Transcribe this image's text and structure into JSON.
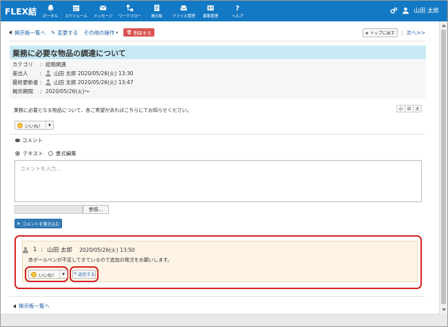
{
  "app": {
    "logo": "FLEX結"
  },
  "nav": [
    {
      "label": "ポータル",
      "icon": "bell-icon"
    },
    {
      "label": "スケジュール",
      "icon": "calendar-icon"
    },
    {
      "label": "メッセージ",
      "icon": "envelope-icon"
    },
    {
      "label": "ワークフロー",
      "icon": "workflow-icon"
    },
    {
      "label": "掲示板",
      "icon": "bulletin-icon"
    },
    {
      "label": "ファイル管理",
      "icon": "inbox-icon"
    },
    {
      "label": "顧客管理",
      "icon": "customer-icon"
    },
    {
      "label": "ヘルプ",
      "icon": "question-icon"
    }
  ],
  "user": {
    "name": "山田 太郎"
  },
  "toolbar": {
    "back": "掲示板一覧へ",
    "edit": "変更する",
    "other": "その他の操作",
    "delete": "削除する",
    "to_top": "トップに出す",
    "next": "次へ>>"
  },
  "post": {
    "title": "業務に必要な物品の調達について",
    "category_label": "カテゴリ",
    "category_value": "総務関連",
    "sender_label": "差出人",
    "sender_name": "山田 太郎",
    "sender_date": "2020/05/26(火) 13:30",
    "updater_label": "最終更新者",
    "updater_name": "山田 太郎",
    "updater_date": "2020/05/26(火) 13:47",
    "period_label": "掲示期間",
    "period_value": "2020/05/26(火)～",
    "sep": ":",
    "body": "業務に必要となる物品について、各ご希望があればこちらにてお知らせください。",
    "size_small": "小",
    "size_mid": "中",
    "size_large": "大",
    "like": "いいね！"
  },
  "comment_form": {
    "heading": "コメント",
    "mode_text": "テキスト",
    "mode_rich": "書式編集",
    "placeholder": "コメントを入力...",
    "browse": "参照...",
    "submit": "コメントを書き込む"
  },
  "comments": [
    {
      "number": "1",
      "sep": ":",
      "author": "山田 太郎",
      "time": "2020/05/26(火) 13:50",
      "text": "赤ボールペンが不足してきているので追加の発注をお願いします。",
      "like": "いいね！",
      "reply": "返信する"
    }
  ],
  "footer": {
    "back": "掲示板一覧へ"
  },
  "colors": {
    "topbar": "#1479c4",
    "title_bg": "#c8e9f3",
    "highlight": "#d21e1e",
    "comment_bg": "#fdf4e6"
  }
}
